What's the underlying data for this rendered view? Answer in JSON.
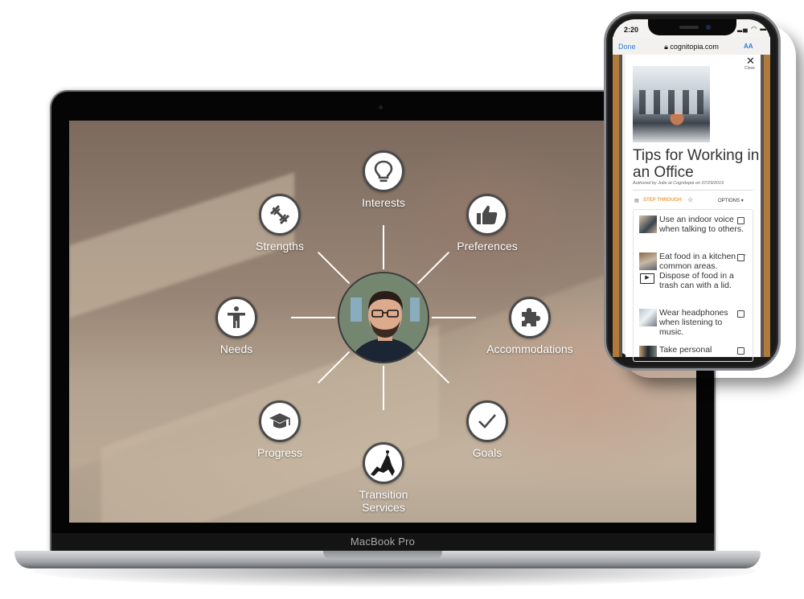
{
  "laptop": {
    "brand_label": "MacBook Pro"
  },
  "hub": {
    "center": {
      "name": "avatar",
      "description": "profile-photo"
    },
    "nodes": [
      {
        "id": "interests",
        "label": "Interests",
        "icon": "lightbulb-icon"
      },
      {
        "id": "preferences",
        "label": "Preferences",
        "icon": "thumbs-up-icon"
      },
      {
        "id": "accommodations",
        "label": "Accommodations",
        "icon": "puzzle-piece-icon"
      },
      {
        "id": "goals",
        "label": "Goals",
        "icon": "checkmark-icon"
      },
      {
        "id": "transition-services",
        "label": "Transition Services",
        "label_line1": "Transition",
        "label_line2": "Services",
        "icon": "mountain-climber-icon"
      },
      {
        "id": "progress",
        "label": "Progress",
        "icon": "graduation-cap-icon"
      },
      {
        "id": "needs",
        "label": "Needs",
        "icon": "accessibility-person-icon"
      },
      {
        "id": "strengths",
        "label": "Strengths",
        "icon": "dumbbell-icon"
      }
    ]
  },
  "phone": {
    "status": {
      "time": "2:20",
      "icons": "signal wifi battery"
    },
    "browser": {
      "done_label": "Done",
      "url": "cognitopia.com",
      "text_size_label": "AA"
    },
    "modal": {
      "close_label": "Close",
      "title": "Tips for Working in an Office",
      "author": "Authored by Julie at Cognitopia on 07/29/2019",
      "step_through_label": "STEP THROUGH",
      "options_label": "OPTIONS",
      "items": [
        {
          "text": "Use an indoor voice when talking to others.",
          "checked": false,
          "has_video": false
        },
        {
          "text": "Eat food in a kitchen or common areas. Dispose of food in a trash can with a lid.",
          "checked": false,
          "has_video": true
        },
        {
          "text": "Wear headphones when listening to music.",
          "checked": false,
          "has_video": false
        },
        {
          "text": "Take personal",
          "checked": false,
          "has_video": false
        }
      ]
    },
    "colors": {
      "accent_orange": "#f0a040",
      "link_blue": "#2a7ad8"
    }
  }
}
